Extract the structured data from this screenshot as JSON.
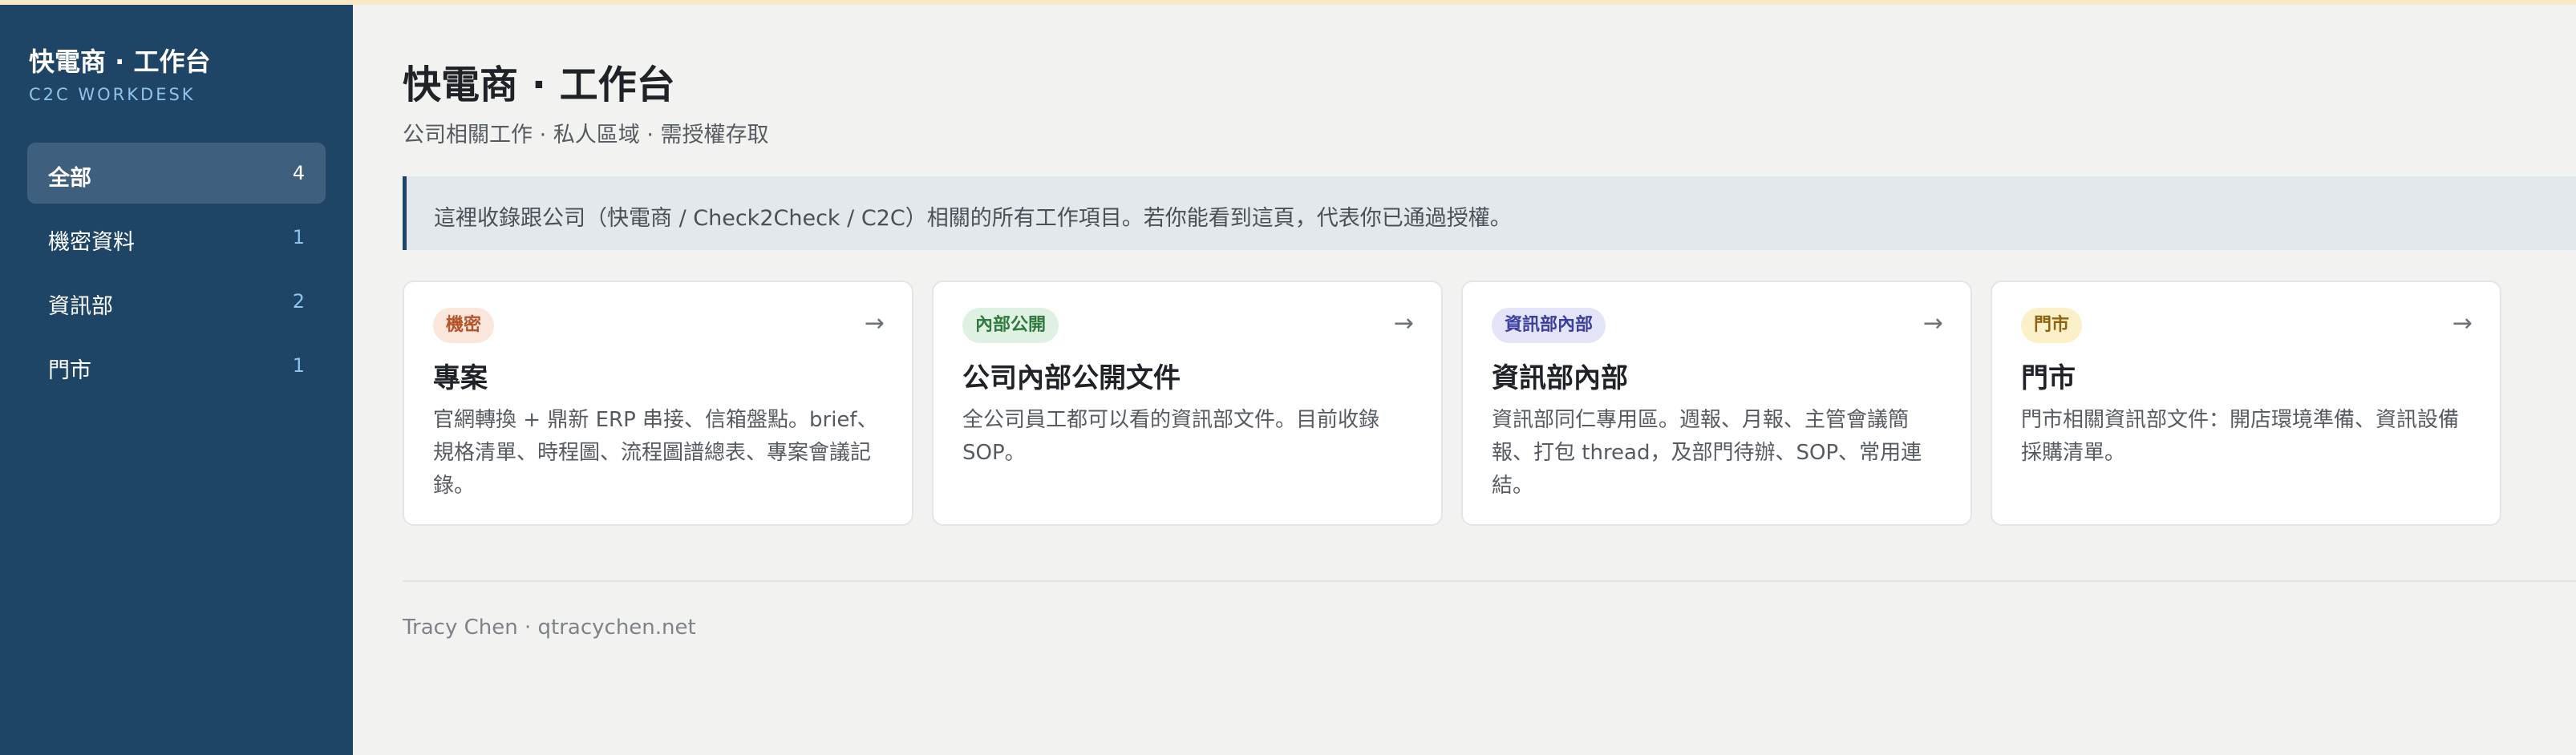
{
  "sidebar": {
    "title": "快電商 · 工作台",
    "subtitle": "C2C WORKDESK",
    "items": [
      {
        "label": "全部",
        "count": "4"
      },
      {
        "label": "機密資料",
        "count": "1"
      },
      {
        "label": "資訊部",
        "count": "2"
      },
      {
        "label": "門市",
        "count": "1"
      }
    ]
  },
  "header": {
    "title": "快電商 · 工作台",
    "subtitle": "公司相關工作 · 私人區域 · 需授權存取"
  },
  "notice": "這裡收錄跟公司（快電商 / Check2Check / C2C）相關的所有工作項目。若你能看到這頁，代表你已通過授權。",
  "cards": [
    {
      "badge": "機密",
      "badge_bg": "#fbe6dc",
      "badge_fg": "#b5532a",
      "title": "專案",
      "desc": "官網轉換 + 鼎新 ERP 串接、信箱盤點。brief、規格清單、時程圖、流程圖譜總表、專案會議記錄。",
      "arrow_icon": "arrow-right-icon"
    },
    {
      "badge": "內部公開",
      "badge_bg": "#dff1e2",
      "badge_fg": "#2f7a3e",
      "title": "公司內部公開文件",
      "desc": "全公司員工都可以看的資訊部文件。目前收錄 SOP。",
      "arrow_icon": "arrow-right-icon"
    },
    {
      "badge": "資訊部內部",
      "badge_bg": "#e4e4f8",
      "badge_fg": "#3b3f9e",
      "title": "資訊部內部",
      "desc": "資訊部同仁專用區。週報、月報、主管會議簡報、打包 thread，及部門待辦、SOP、常用連結。",
      "arrow_icon": "arrow-right-icon"
    },
    {
      "badge": "門市",
      "badge_bg": "#fbf0c8",
      "badge_fg": "#8a6410",
      "title": "門市",
      "desc": "門市相關資訊部文件：開店環境準備、資訊設備採購清單。",
      "arrow_icon": "arrow-right-icon"
    }
  ],
  "footer": "Tracy Chen · qtracychen.net"
}
